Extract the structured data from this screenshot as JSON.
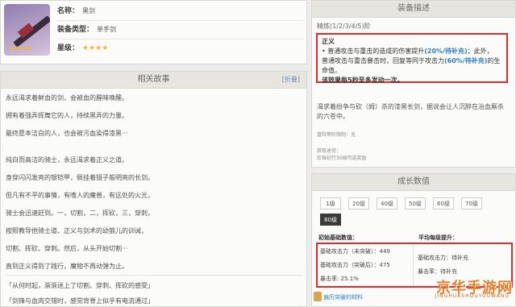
{
  "info": {
    "stars": "★★★★",
    "name_label": "名称：",
    "name_value": "黑剑",
    "type_label": "装备类型：",
    "type_value": "单手剑",
    "star_label": "星级：",
    "star_value": "★★★★"
  },
  "story": {
    "title": "相关故事",
    "fold": "[折叠]",
    "lines": [
      "永远渴求着鲜血的剑，会被血的腥味唤醒。",
      "拥有着强弄挥舞它的人，持续黑弄的力量。",
      "最终愿本洁白的人，也会被污血染得漆黑···",
      "纯白而高洁的骑士，永远渴求着正义之道。",
      "身穿闪闪发亮的银铠甲，佩挂着镜子般明亮的长剑。",
      "但凡有不平的事情，有嗜人的魔兽，有远处的火光，",
      "骑士会迅速赶到。一，切割，二，挥砍，三，穿刺，",
      "按照教导他骑士道、正义与剑术的幼狼儿的训诫，",
      "切割、挥砍、穿刺。然后，从头开始切割···",
      "直到正义得到了践行，魔物不再动弹为止。",
      "「从何时起，渐渐迷上了切割、穿刺、挥砍的感受」",
      "「剑锋与血肉交错时，感觉背脊上似乎有电流通过」"
    ]
  },
  "desc": {
    "title": "装备描述",
    "refine": "精炼(1/2/3/4/5)阶",
    "effect_title": "正义",
    "effect_1a": "• 普通攻击与重击的造成的伤害提升",
    "effect_1b": "(20%/待补充)",
    "effect_1c": "；此外，",
    "effect_2": "普通攻击与重击暴击时，回复等同于攻击力",
    "effect_2b": "(60%/待补充)",
    "effect_2c": "的生命值。",
    "effect_3": "该效果每5秒至多发动一次。",
    "flavor": "渴求着纷争与砍（姆）杀的漆黑长剑，据说会让人沉醉在治血厮杀的六苍中。",
    "break_info": "冒险等阶限制：无",
    "source_label": "获取途径：",
    "source_value": "珍珠纪行30级可选奖励"
  },
  "growth": {
    "title": "成长数值",
    "levels": [
      "1级",
      "20级",
      "40级",
      "50级",
      "60级",
      "70级",
      "80级"
    ],
    "selected": "80级",
    "base_header": "初始基础数值：",
    "avg_header": "平均每级提升：",
    "base_atk_pre": "基础攻击力（未突破）：449",
    "base_atk_post": "基础攻击力（突破后）：475",
    "crit": "暴击率: 25.1%",
    "avg_atk": "基础攻击力：待补充",
    "avg_crit": "暴击率：待补充",
    "foot": "遍历突破的材料"
  },
  "watermark": {
    "main": "京华手游网",
    "sub": "JINGHUASHOUYOUWANG"
  }
}
